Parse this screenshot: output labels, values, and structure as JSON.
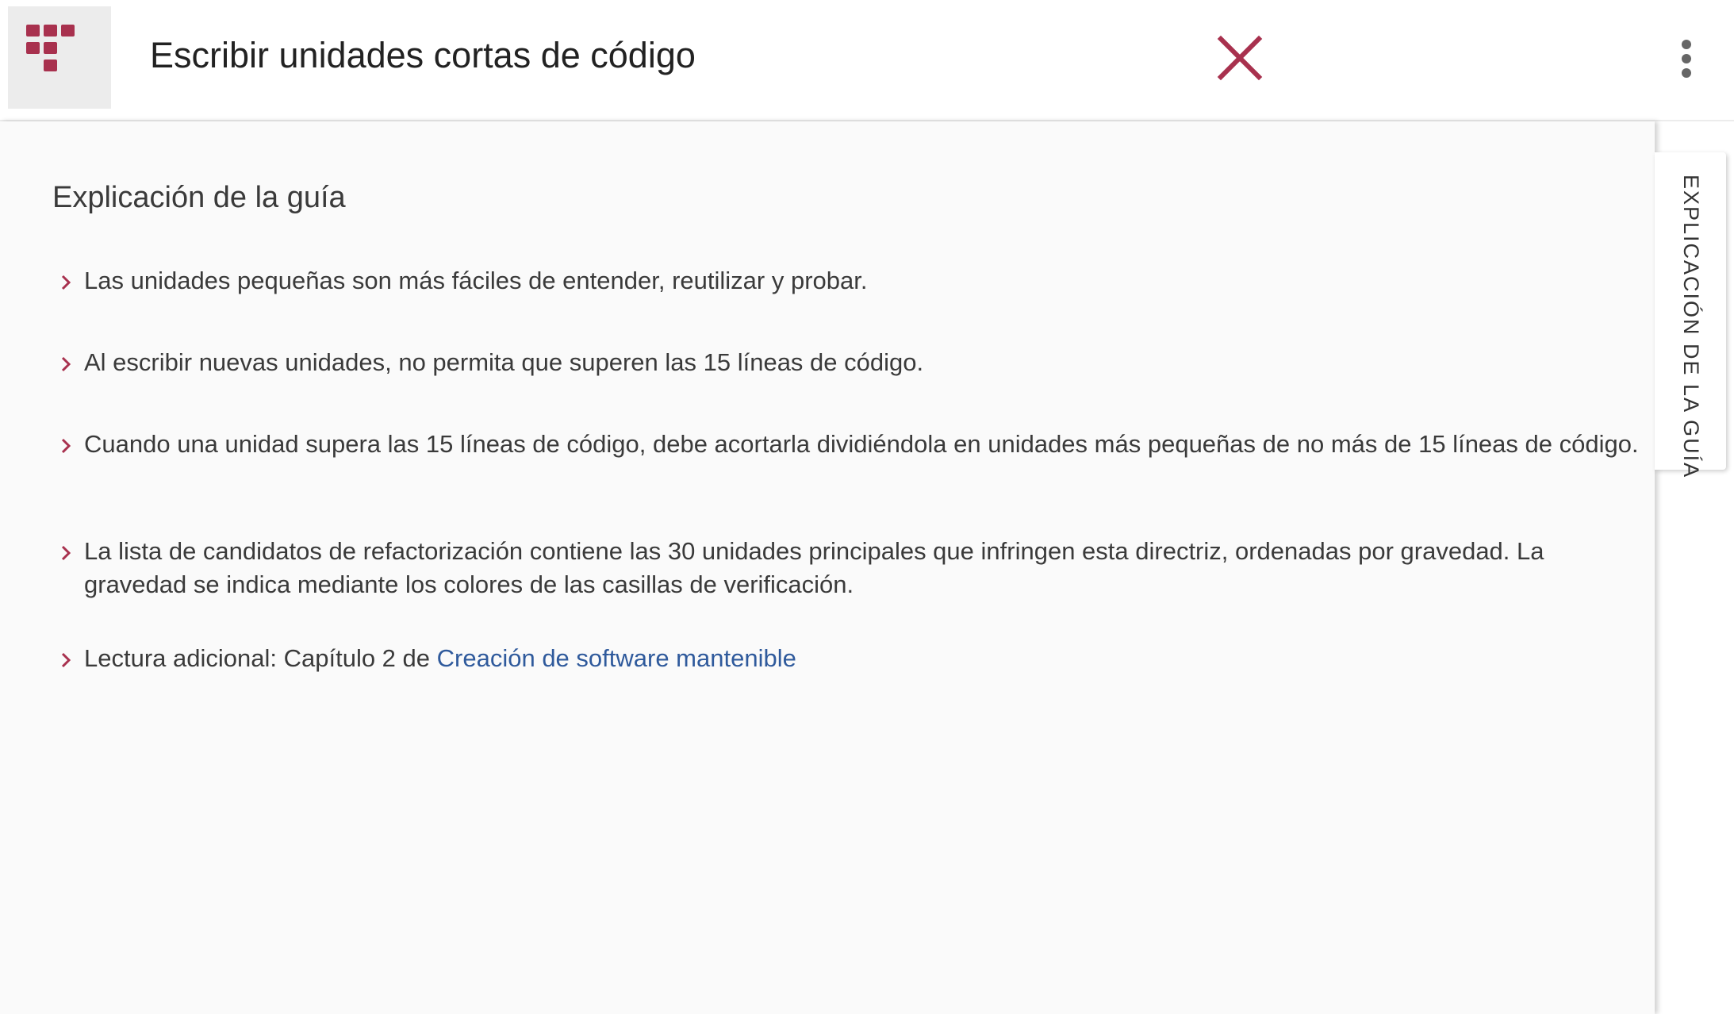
{
  "header": {
    "title": "Escribir unidades cortas de código",
    "logo_icon": "grid-logo-icon",
    "close_icon": "close-icon",
    "more_icon": "more-vertical-icon"
  },
  "colors": {
    "accent": "#a8314e",
    "link": "#2f5a9c",
    "panel_background": "#fafafa"
  },
  "guide": {
    "section_title": "Explicación de la guía",
    "items": [
      {
        "text": "Las unidades pequeñas son más fáciles de entender, reutilizar y probar."
      },
      {
        "text": "Al escribir nuevas unidades, no permita que superen las 15 líneas de código."
      },
      {
        "text": "Cuando una unidad supera las 15 líneas de código, debe acortarla dividiéndola en unidades más pequeñas de no más de 15 líneas de código."
      },
      {
        "text": "La lista de candidatos de refactorización contiene las 30 unidades principales que infringen esta directriz, ordenadas por gravedad. La gravedad se indica mediante los colores de las casillas de verificación."
      },
      {
        "prefix": "Lectura adicional: Capítulo 2 de ",
        "link_text": "Creación de software mantenible"
      }
    ]
  },
  "side_tab": {
    "label": "EXPLICACIÓN DE LA GUÍA"
  }
}
